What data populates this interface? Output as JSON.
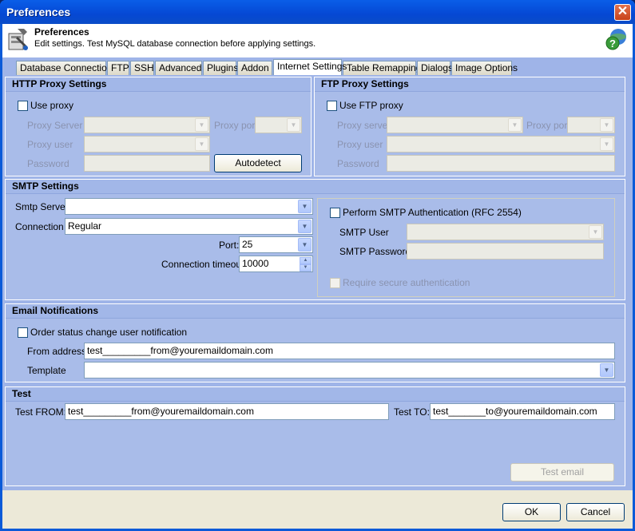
{
  "window": {
    "title": "Preferences",
    "close_symbol": "✕"
  },
  "header": {
    "title": "Preferences",
    "subtitle": "Edit settings. Test MySQL database connection before applying settings."
  },
  "tabs": [
    {
      "label": "Database Connection"
    },
    {
      "label": "FTP"
    },
    {
      "label": "SSH"
    },
    {
      "label": "Advanced"
    },
    {
      "label": "Plugins"
    },
    {
      "label": "Addon"
    },
    {
      "label": "Internet Settings"
    },
    {
      "label": "Table Remapping"
    },
    {
      "label": "Dialogs"
    },
    {
      "label": "Image Options"
    }
  ],
  "http_proxy": {
    "heading": "HTTP Proxy Settings",
    "use_proxy_label": "Use proxy",
    "server_label": "Proxy Server",
    "port_label": "Proxy port",
    "user_label": "Proxy user",
    "password_label": "Password",
    "autodetect_label": "Autodetect"
  },
  "ftp_proxy": {
    "heading": "FTP Proxy Settings",
    "use_proxy_label": "Use FTP proxy",
    "server_label": "Proxy server",
    "port_label": "Proxy port",
    "user_label": "Proxy user",
    "password_label": "Password"
  },
  "smtp": {
    "heading": "SMTP Settings",
    "server_label": "Smtp Server",
    "server_value": "",
    "connection_label": "Connection",
    "connection_value": "Regular",
    "port_label": "Port:",
    "port_value": "25",
    "timeout_label": "Connection timeout:",
    "timeout_value": "10000",
    "auth_label": "Perform SMTP Authentication (RFC 2554)",
    "user_label": "SMTP User",
    "password_label": "SMTP Password",
    "secure_label": "Require secure authentication"
  },
  "email_notifications": {
    "heading": "Email Notifications",
    "order_status_label": "Order status change user notification",
    "from_label": "From address:",
    "from_value": "test_________from@youremaildomain.com",
    "template_label": "Template",
    "template_value": ""
  },
  "test": {
    "heading": "Test",
    "from_label": "Test FROM:",
    "from_value": "test_________from@youremaildomain.com",
    "to_label": "Test TO:",
    "to_value": "test_______to@youremaildomain.com",
    "send_label": "Test email"
  },
  "footer": {
    "ok_label": "OK",
    "cancel_label": "Cancel"
  },
  "icons": {
    "dropdown": "▼",
    "spin_up": "▲",
    "spin_down": "▼"
  }
}
